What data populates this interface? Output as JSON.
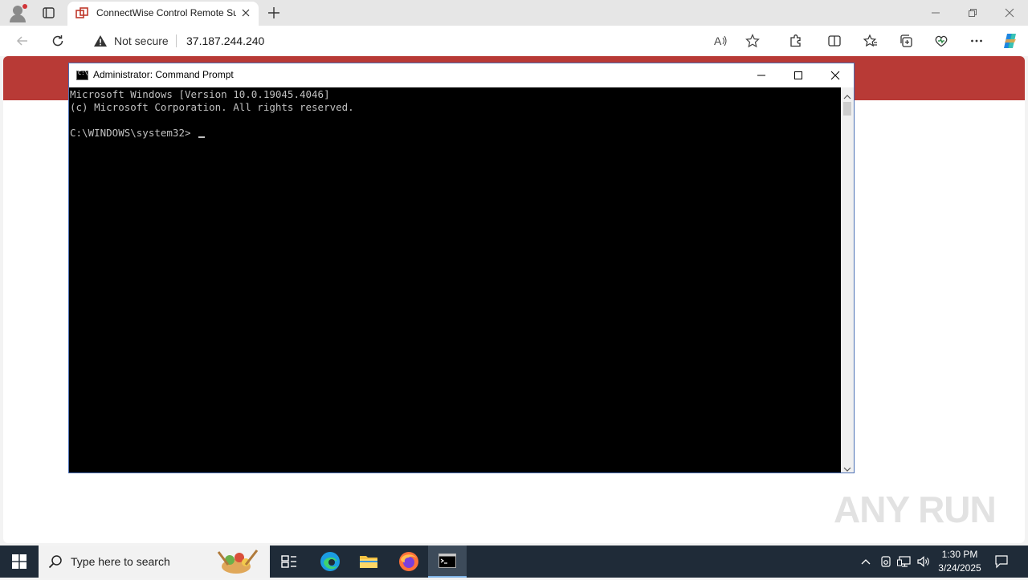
{
  "browser": {
    "tab_title": "ConnectWise Control Remote Su",
    "security_label": "Not secure",
    "url": "37.187.244.240"
  },
  "cmd_window": {
    "title": "Administrator: Command Prompt",
    "icon_text": "C:\\",
    "lines": [
      "Microsoft Windows [Version 10.0.19045.4046]",
      "(c) Microsoft Corporation. All rights reserved.",
      "",
      "C:\\WINDOWS\\system32>"
    ]
  },
  "watermark": {
    "text": "ANY RUN"
  },
  "taskbar": {
    "search_placeholder": "Type here to search",
    "time": "1:30 PM",
    "date": "3/24/2025"
  },
  "colors": {
    "banner": "#b83a36",
    "taskbar": "#1f2b38",
    "console_bg": "#000000",
    "console_text": "#c0c0c0"
  }
}
